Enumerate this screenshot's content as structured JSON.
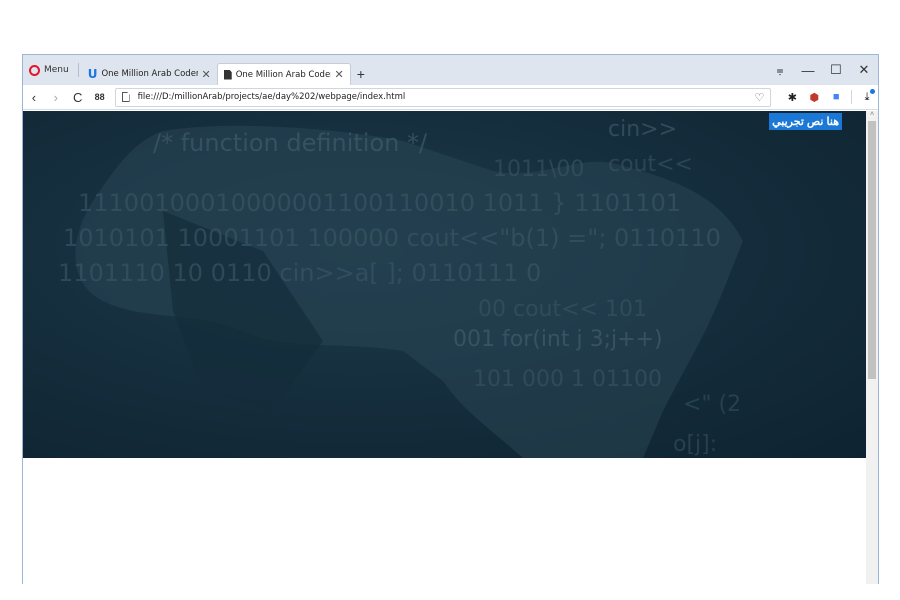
{
  "browser": {
    "menu_label": "Menu",
    "tabs": [
      {
        "title": "One Million Arab Coders",
        "active": false
      },
      {
        "title": "One Million Arab Coders",
        "active": true
      }
    ],
    "new_tab_symbol": "+",
    "close_symbol": "✕",
    "window_controls": {
      "tab_menu": "⩦",
      "minimize": "—",
      "maximize": "☐",
      "close": "✕"
    },
    "address": "file:///D:/millionArab/projects/ae/day%202/webpage/index.html",
    "nav": {
      "back": "‹",
      "forward": "›",
      "reload": "C",
      "speed_dial": "88"
    }
  },
  "page": {
    "overlay_text": "هنا نص تجريبي",
    "hero_code_lines": [
      "/*  function definition  */",
      "cin>>",
      "1011\\00",
      "cout<<",
      "11100100010000001100110010  1011  }  1101101",
      "1010101   10001101     100000    cout<<\"b(1) =\";   0110110",
      "1101110        10            0110  cin>>a[ ];      0110111 0",
      "00  cout<<           101",
      "001  for(int j       3;j++)",
      "101 000   1            01100",
      "<\"   (2",
      "o[j]:"
    ]
  },
  "colors": {
    "hero_bg": "#142c3b",
    "overlay_bg": "#1b78d6",
    "opera_red": "#e3162b",
    "accent_blue": "#1b74e8"
  },
  "icons": {
    "back": "chevron-left-icon",
    "forward": "chevron-right-icon",
    "reload": "reload-icon",
    "speed_dial": "speed-dial-icon",
    "page": "page-icon",
    "heart": "heart-icon",
    "extensions": [
      "gear-icon",
      "ublock-icon",
      "translate-icon"
    ],
    "download": "download-icon"
  }
}
